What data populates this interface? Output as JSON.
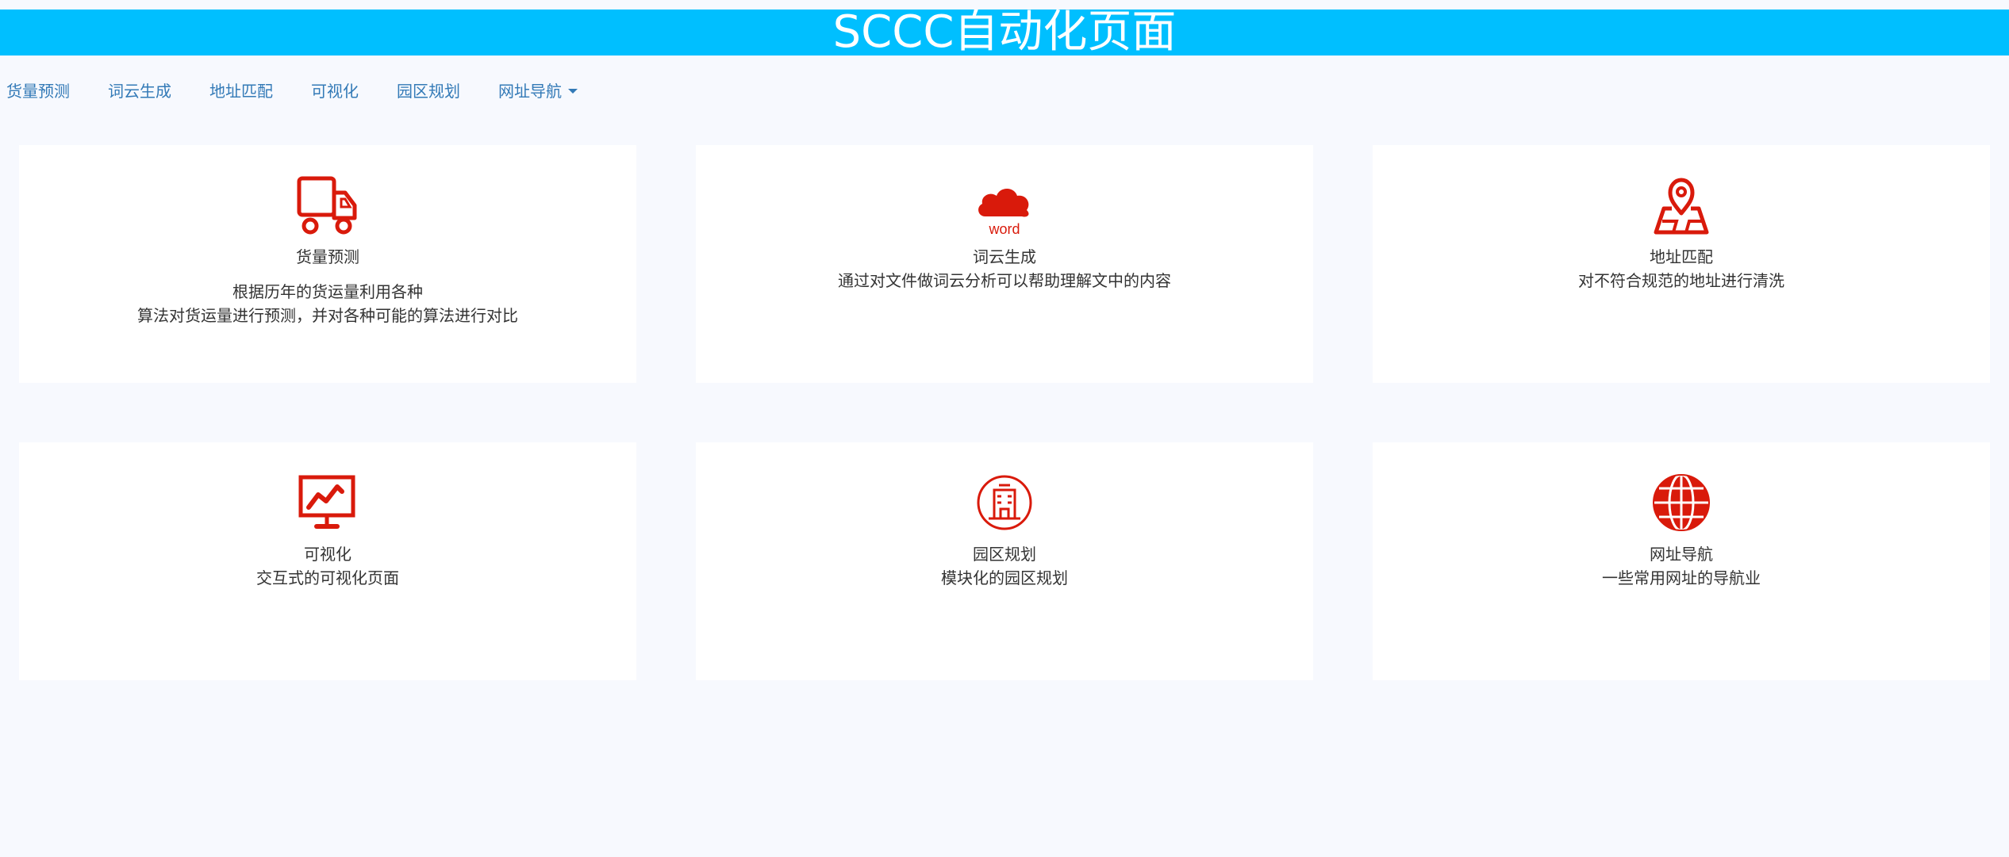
{
  "header": {
    "title": "SCCC自动化页面"
  },
  "nav": {
    "items": [
      "货量预测",
      "词云生成",
      "地址匹配",
      "可视化",
      "园区规划",
      "网址导航"
    ]
  },
  "colors": {
    "header_bg": "#00bfff",
    "icon": "#d91a0b",
    "nav_link": "#337ab7",
    "page_bg": "#f7f9fe"
  },
  "cards": [
    {
      "icon": "truck-icon",
      "title": "货量预测",
      "desc_line1": "根据历年的货运量利用各种",
      "desc_line2": "算法对货运量进行预测，并对各种可能的算法进行对比"
    },
    {
      "icon": "word-cloud-icon",
      "icon_text": "word",
      "title": "词云生成",
      "desc_line1": "通过对文件做词云分析可以帮助理解文中的内容"
    },
    {
      "icon": "map-pin-icon",
      "title": "地址匹配",
      "desc_line1": "对不符合规范的地址进行清洗"
    },
    {
      "icon": "monitor-chart-icon",
      "title": "可视化",
      "desc_line1": "交互式的可视化页面"
    },
    {
      "icon": "building-icon",
      "title": "园区规划",
      "desc_line1": "模块化的园区规划"
    },
    {
      "icon": "globe-icon",
      "title": "网址导航",
      "desc_line1": "一些常用网址的导航业"
    }
  ]
}
